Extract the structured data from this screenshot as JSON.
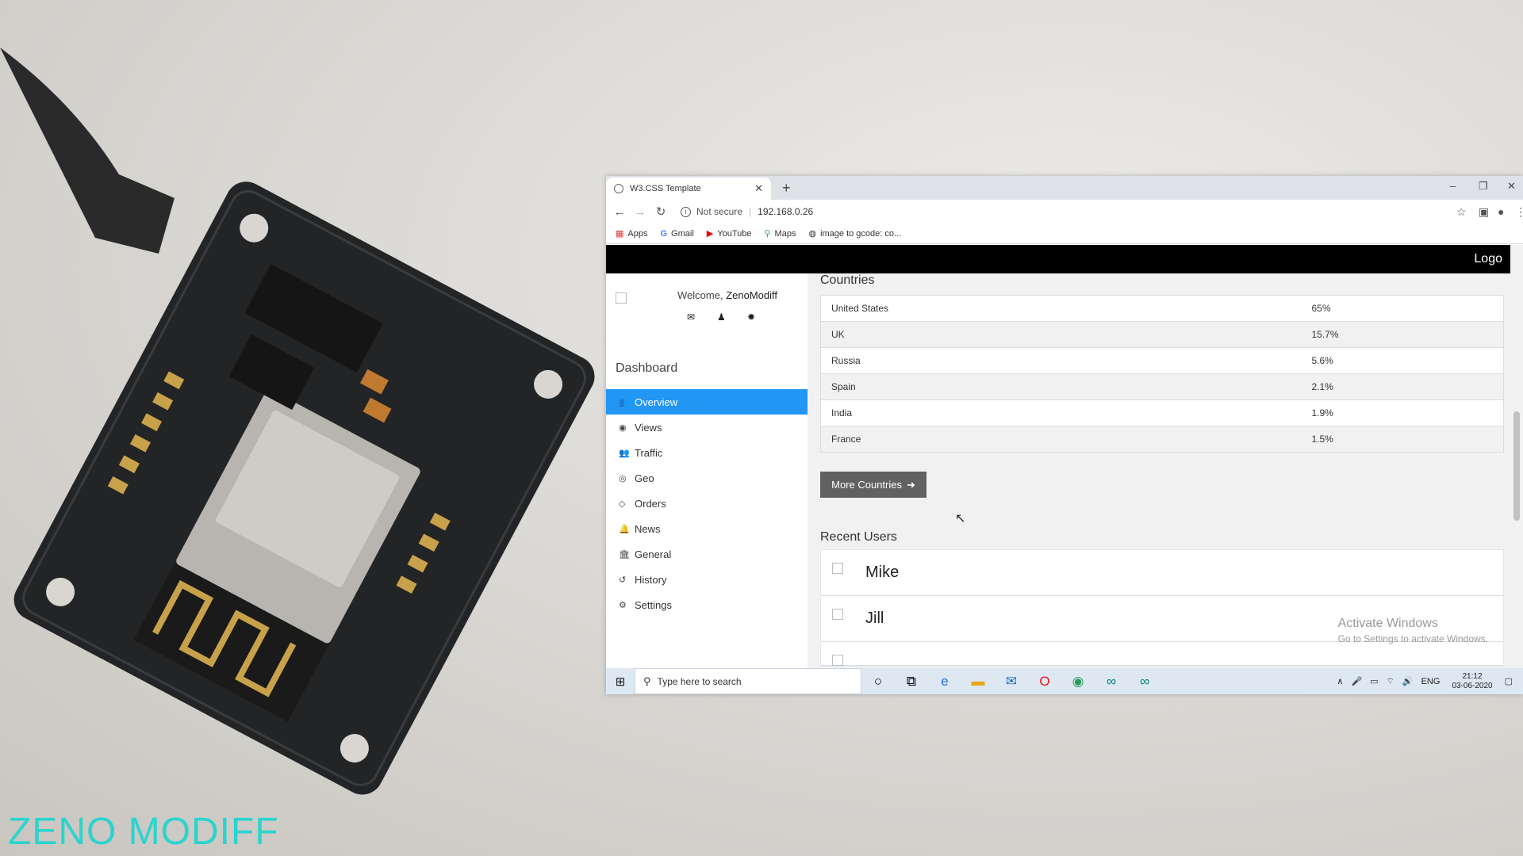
{
  "watermark": "ZENO MODIFF",
  "browser": {
    "tab_title": "W3.CSS Template",
    "tab_close": "✕",
    "new_tab": "+",
    "window_controls": [
      "–",
      "❐",
      "✕"
    ],
    "security_label": "Not secure",
    "url": "192.168.0.26",
    "bookmarks": [
      {
        "label": "Apps",
        "icon": "apps-grid-icon"
      },
      {
        "label": "Gmail",
        "icon": "google-icon"
      },
      {
        "label": "YouTube",
        "icon": "youtube-icon"
      },
      {
        "label": "Maps",
        "icon": "maps-pin-icon"
      },
      {
        "label": "image to gcode: co...",
        "icon": "globe-icon"
      }
    ]
  },
  "page": {
    "logo": "Logo",
    "welcome_prefix": "Welcome,",
    "username": "ZenoModiff",
    "dashboard_title": "Dashboard",
    "menu": [
      {
        "label": "Overview",
        "icon": "users-icon",
        "active": true
      },
      {
        "label": "Views",
        "icon": "eye-icon"
      },
      {
        "label": "Traffic",
        "icon": "users-icon"
      },
      {
        "label": "Geo",
        "icon": "bullseye-icon"
      },
      {
        "label": "Orders",
        "icon": "diamond-icon"
      },
      {
        "label": "News",
        "icon": "bell-icon"
      },
      {
        "label": "General",
        "icon": "bank-icon"
      },
      {
        "label": "History",
        "icon": "history-icon"
      },
      {
        "label": "Settings",
        "icon": "cog-icon"
      }
    ],
    "countries_heading": "Countries",
    "countries": [
      {
        "name": "United States",
        "pct": "65%"
      },
      {
        "name": "UK",
        "pct": "15.7%"
      },
      {
        "name": "Russia",
        "pct": "5.6%"
      },
      {
        "name": "Spain",
        "pct": "2.1%"
      },
      {
        "name": "India",
        "pct": "1.9%"
      },
      {
        "name": "France",
        "pct": "1.5%"
      }
    ],
    "more_countries_label": "More Countries",
    "recent_users_heading": "Recent Users",
    "users": [
      "Mike",
      "Jill"
    ],
    "activate_title": "Activate Windows",
    "activate_sub": "Go to Settings to activate Windows."
  },
  "taskbar": {
    "search_placeholder": "Type here to search",
    "language": "ENG",
    "time": "21:12",
    "date": "03-06-2020"
  },
  "colors": {
    "accent": "#2196f3",
    "topbar": "#000000",
    "watermark": "#2ad4cf",
    "button": "#616161"
  }
}
